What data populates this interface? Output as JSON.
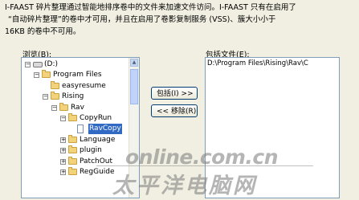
{
  "description": {
    "line1": "I-FAAST 碎片整理通过智能地排序卷中的文件来加速文件访问。I-FAAST 只有在启用了",
    "line2": "“自动碎片整理”的卷中才可用，并且在启用了卷影复制服务 (VSS)、簇大小小于",
    "line3": "16KB 的卷中不可用。"
  },
  "browse": {
    "label": "浏览(B):",
    "tree": [
      {
        "label": "(D:)",
        "icon": "drive-icon",
        "expander": "−",
        "depth": 0
      },
      {
        "label": "Program Files",
        "icon": "folder-icon",
        "expander": "−",
        "depth": 1
      },
      {
        "label": "easyresume",
        "icon": "folder-icon",
        "expander": "",
        "depth": 2
      },
      {
        "label": "Rising",
        "icon": "folder-icon",
        "expander": "−",
        "depth": 2
      },
      {
        "label": "Rav",
        "icon": "folder-icon",
        "expander": "−",
        "depth": 3
      },
      {
        "label": "CopyRun",
        "icon": "folder-icon",
        "expander": "−",
        "depth": 4
      },
      {
        "label": "RavCopy",
        "icon": "file-icon",
        "expander": "",
        "depth": 5,
        "selected": true
      },
      {
        "label": "Language",
        "icon": "folder-icon",
        "expander": "+",
        "depth": 4
      },
      {
        "label": "plugin",
        "icon": "folder-icon",
        "expander": "+",
        "depth": 4
      },
      {
        "label": "PatchOut",
        "icon": "folder-icon",
        "expander": "+",
        "depth": 4
      },
      {
        "label": "RegGuide",
        "icon": "folder-icon",
        "expander": "+",
        "depth": 4
      }
    ]
  },
  "buttons": {
    "include": "包括(I) >>",
    "remove": "<< 移除(R)"
  },
  "included": {
    "label": "包括文件(E):",
    "items": [
      "D:\\Program Files\\Rising\\Rav\\C"
    ]
  },
  "watermark": {
    "en": "online.com.cn",
    "cn": "太平洋电脑网"
  }
}
